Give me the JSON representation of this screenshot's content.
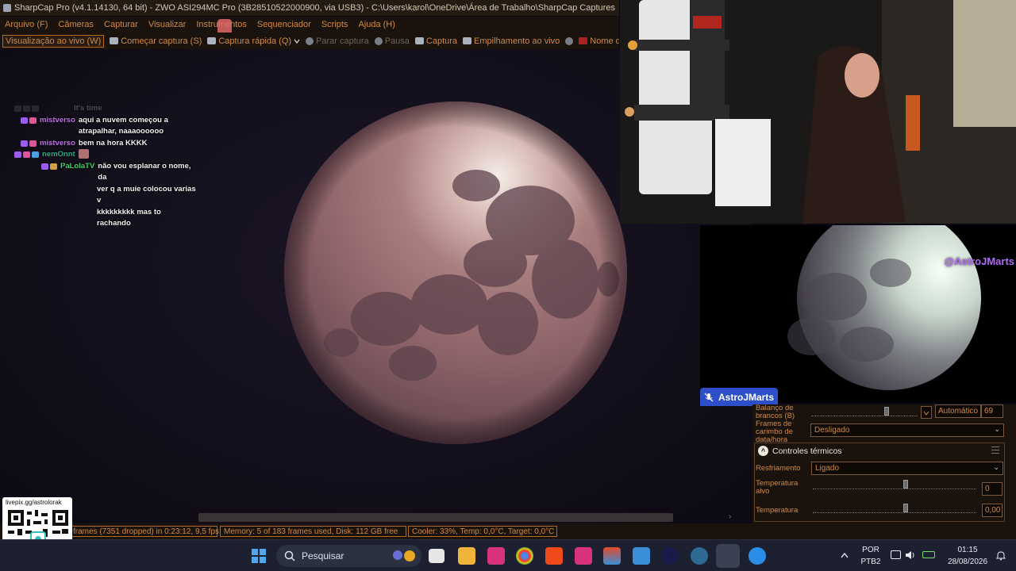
{
  "window": {
    "title": "SharpCap Pro (v4.1.14130, 64 bit) - ZWO ASI294MC Pro (3B28510522000900, via USB3) - C:\\Users\\karol\\OneDrive\\Área de Trabalho\\SharpCap Captures"
  },
  "menu": [
    "Arquivo (F)",
    "Câmeras",
    "Capturar",
    "Visualizar",
    "Instrumentos",
    "Sequenciador",
    "Scripts",
    "Ajuda (H)"
  ],
  "toolbar": {
    "live": "Visualização ao vivo (W)",
    "start_capture": "Começar captura (S)",
    "quick_capture": "Captura rápida (Q)",
    "stop_capture": "Parar captura",
    "pause": "Pausa",
    "snapshot": "Captura",
    "live_stack": "Empilhamento ao vivo",
    "target_name": "Nome de destino"
  },
  "chat": [
    {
      "user": "",
      "text": "It's time",
      "color": "#6a6a6a"
    },
    {
      "user": "mistverso",
      "text": "aqui a nuvem começou a atrapalhar, naaaoooooo",
      "color": "#c56cf0"
    },
    {
      "user": "mistverso",
      "text": "bem na hora KKKK",
      "color": "#c56cf0"
    },
    {
      "user": "nemOnnt",
      "text": "",
      "color": "#2fa88a"
    },
    {
      "user": "PaLolaTV",
      "text": "",
      "color": "#3fd16a"
    },
    {
      "text": "não vou esplanar o nome, da"
    },
    {
      "text": "ver q a muie colocou varias v"
    },
    {
      "text": "kkkkkkkkk mas to rachando"
    }
  ],
  "overlay": {
    "watermark": "@AstroJMarts",
    "streamer_tag": "AstroJMarts",
    "qr_label": "livepix.gg/astrolorak"
  },
  "panel": {
    "white_balance_label": "Balanço de brancos (B)",
    "white_balance_mode": "Automático",
    "white_balance_value": "69",
    "timestamp_label": "Frames de carimbo de data/hora",
    "timestamp_value": "Desligado",
    "thermal_title": "Controles térmicos",
    "cooling_label": "Resfriamento",
    "cooling_value": "Ligado",
    "target_temp_label": "Temperatura alvo",
    "target_temp_value": "0",
    "temp_label": "Temperatura",
    "temp_value": "0,00"
  },
  "status": {
    "frames": "frames (7351 dropped) in 0:23:12, 9,5 fps",
    "memory": "Memory: 5 of 183 frames used, Disk: 112 GB free",
    "cooler": "Cooler: 33%, Temp: 0,0°C, Target: 0,0°C"
  },
  "taskbar": {
    "search": "Pesquisar",
    "lang_top": "POR",
    "lang_bottom": "PTB2",
    "time": "01:15",
    "date": "28/08/2026"
  }
}
